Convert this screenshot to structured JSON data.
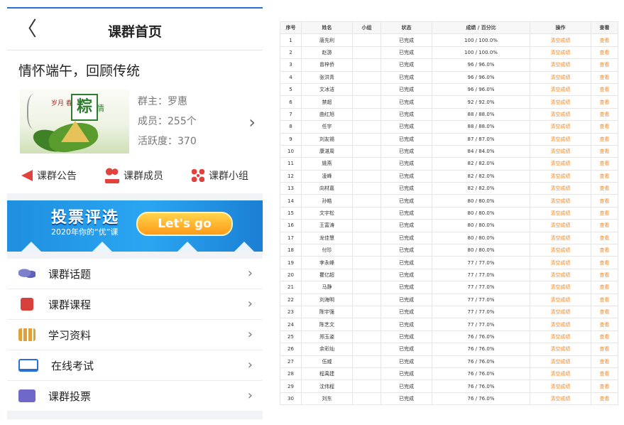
{
  "phone": {
    "nav": {
      "back_symbol": "〈",
      "title": "课群首页"
    },
    "group": {
      "title": "情怀端午，回顾传统",
      "cover": {
        "sign_char": "粽",
        "tagline": "岁月 春秋",
        "tag2": "情"
      },
      "owner_label": "群主：罗惠",
      "members_label": "成员：255个",
      "activity_label": "活跃度：370"
    },
    "actions": [
      {
        "icon": "megaphone-icon",
        "label": "课群公告"
      },
      {
        "icon": "users-icon",
        "label": "课群成员"
      },
      {
        "icon": "network-icon",
        "label": "课群小组"
      }
    ],
    "banner": {
      "title": "投票评选",
      "subtitle": "2020年你的“优”课",
      "button": "Let's go"
    },
    "menu": [
      {
        "icon": "chat-icon",
        "label": "课群话题"
      },
      {
        "icon": "book-icon",
        "label": "课群课程"
      },
      {
        "icon": "folder-icon",
        "label": "学习资料"
      },
      {
        "icon": "laptop-icon",
        "label": "在线考试"
      },
      {
        "icon": "ticket-icon",
        "label": "课群投票"
      }
    ],
    "colors": {
      "accent": "#2a6fd6",
      "icon_red": "#e2413e",
      "banner_blue": "#2aa6f1"
    }
  },
  "table": {
    "headers": [
      "序号",
      "姓名",
      "小组",
      "状态",
      "成绩 / 百分比",
      "操作",
      "查看"
    ],
    "action_label": "清空成绩",
    "view_label": "查看",
    "rows": [
      {
        "no": "1",
        "name": "唐先利",
        "group": "",
        "status": "已完成",
        "score": "100 / 100.0%"
      },
      {
        "no": "2",
        "name": "赵游",
        "group": "",
        "status": "已完成",
        "score": "100 / 100.0%"
      },
      {
        "no": "3",
        "name": "曾梓侨",
        "group": "",
        "status": "已完成",
        "score": "96 / 96.0%"
      },
      {
        "no": "4",
        "name": "张洪青",
        "group": "",
        "status": "已完成",
        "score": "96 / 96.0%"
      },
      {
        "no": "5",
        "name": "文冰洁",
        "group": "",
        "status": "已完成",
        "score": "96 / 96.0%"
      },
      {
        "no": "6",
        "name": "禁超",
        "group": "",
        "status": "已完成",
        "score": "92 / 92.0%"
      },
      {
        "no": "7",
        "name": "曲红旭",
        "group": "",
        "status": "已完成",
        "score": "88 / 88.0%"
      },
      {
        "no": "8",
        "name": "任宇",
        "group": "",
        "status": "已完成",
        "score": "88 / 88.0%"
      },
      {
        "no": "9",
        "name": "刘友锡",
        "group": "",
        "status": "已完成",
        "score": "87 / 87.0%"
      },
      {
        "no": "10",
        "name": "康湛周",
        "group": "",
        "status": "已完成",
        "score": "84 / 84.0%"
      },
      {
        "no": "11",
        "name": "姚燕",
        "group": "",
        "status": "已完成",
        "score": "82 / 82.0%"
      },
      {
        "no": "12",
        "name": "凌峰",
        "group": "",
        "status": "已完成",
        "score": "82 / 82.0%"
      },
      {
        "no": "13",
        "name": "向材嘉",
        "group": "",
        "status": "已完成",
        "score": "82 / 82.0%"
      },
      {
        "no": "14",
        "name": "孙皓",
        "group": "",
        "status": "已完成",
        "score": "80 / 80.0%"
      },
      {
        "no": "15",
        "name": "文宇松",
        "group": "",
        "status": "已完成",
        "score": "80 / 80.0%"
      },
      {
        "no": "16",
        "name": "王富涛",
        "group": "",
        "status": "已完成",
        "score": "80 / 80.0%"
      },
      {
        "no": "17",
        "name": "龙佳慧",
        "group": "",
        "status": "已完成",
        "score": "80 / 80.0%"
      },
      {
        "no": "18",
        "name": "付珍",
        "group": "",
        "status": "已完成",
        "score": "80 / 80.0%"
      },
      {
        "no": "19",
        "name": "李永峰",
        "group": "",
        "status": "已完成",
        "score": "77 / 77.0%"
      },
      {
        "no": "20",
        "name": "瞿亿超",
        "group": "",
        "status": "已完成",
        "score": "77 / 77.0%"
      },
      {
        "no": "21",
        "name": "马静",
        "group": "",
        "status": "已完成",
        "score": "77 / 77.0%"
      },
      {
        "no": "22",
        "name": "刘海明",
        "group": "",
        "status": "已完成",
        "score": "77 / 77.0%"
      },
      {
        "no": "23",
        "name": "陈宇强",
        "group": "",
        "status": "已完成",
        "score": "77 / 77.0%"
      },
      {
        "no": "24",
        "name": "陈艺文",
        "group": "",
        "status": "已完成",
        "score": "77 / 77.0%"
      },
      {
        "no": "25",
        "name": "郑玉姿",
        "group": "",
        "status": "已完成",
        "score": "76 / 76.0%"
      },
      {
        "no": "26",
        "name": "余彩灿",
        "group": "",
        "status": "已完成",
        "score": "76 / 76.0%"
      },
      {
        "no": "27",
        "name": "伍威",
        "group": "",
        "status": "已完成",
        "score": "76 / 76.0%"
      },
      {
        "no": "28",
        "name": "程禹建",
        "group": "",
        "status": "已完成",
        "score": "76 / 76.0%"
      },
      {
        "no": "29",
        "name": "沈伟程",
        "group": "",
        "status": "已完成",
        "score": "76 / 76.0%"
      },
      {
        "no": "30",
        "name": "刘东",
        "group": "",
        "status": "已完成",
        "score": "76 / 76.0%"
      }
    ]
  }
}
